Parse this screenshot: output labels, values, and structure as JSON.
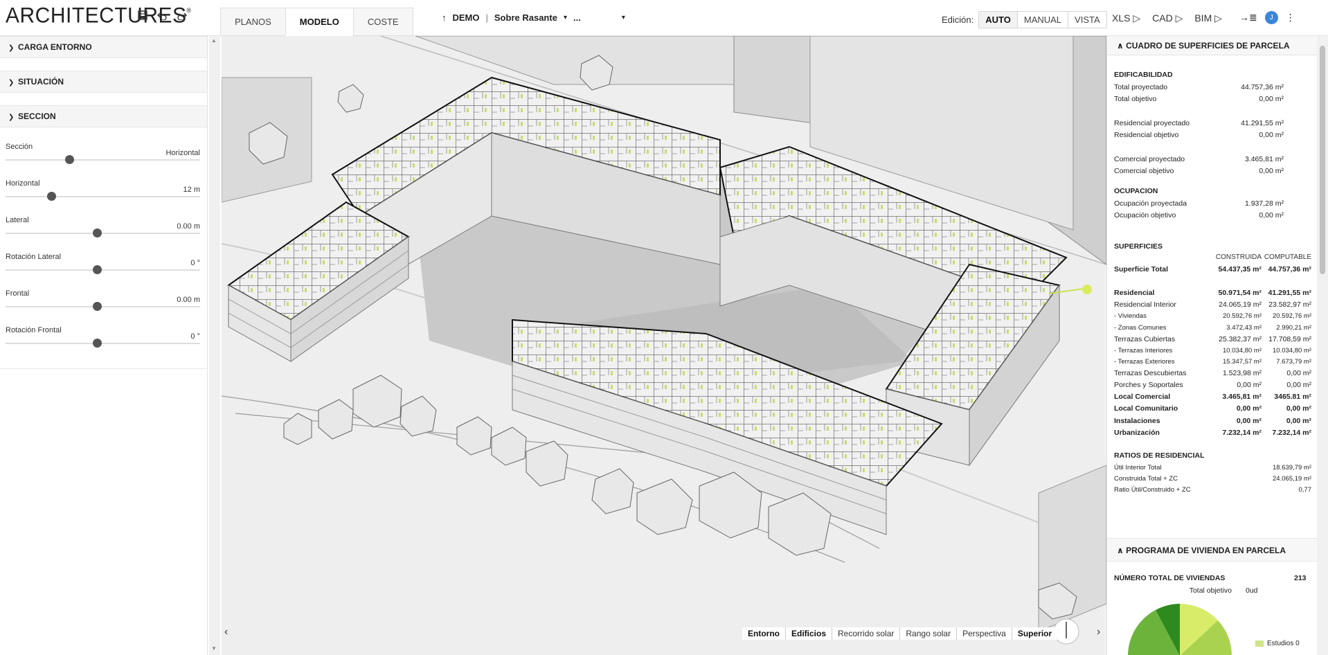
{
  "app": {
    "logo": "ARCHITECTURES",
    "logo_mark": "®"
  },
  "toolbar": {
    "save_icon": "save-icon",
    "undo_icon": "undo-icon",
    "redo_icon": "redo-icon"
  },
  "tabs": [
    {
      "label": "PLANOS"
    },
    {
      "label": "MODELO"
    },
    {
      "label": "COSTE"
    }
  ],
  "project": {
    "name": "DEMO",
    "level": "Sobre Rasante",
    "more": "..."
  },
  "edicion": {
    "label": "Edición:",
    "modes": [
      "AUTO",
      "MANUAL",
      "VISTA"
    ],
    "active": "AUTO"
  },
  "exports": [
    "XLS ▷",
    "CAD ▷",
    "BIM ▷"
  ],
  "user": {
    "initial": "J"
  },
  "left": {
    "sections": [
      "CARGA ENTORNO",
      "SITUACIÓN",
      "SECCION"
    ],
    "sliders": [
      {
        "label": "Sección",
        "value": "Horizontal",
        "level": 0.35
      },
      {
        "label": "Horizontal",
        "value": "12 m",
        "level": 0.25
      },
      {
        "label": "Lateral",
        "value": "0.00 m",
        "level": 0.5
      },
      {
        "label": "Rotación Lateral",
        "value": "0 °",
        "level": 0.5
      },
      {
        "label": "Frontal",
        "value": "0.00 m",
        "level": 0.5
      },
      {
        "label": "Rotación Frontal",
        "value": "0 °",
        "level": 0.5
      }
    ]
  },
  "view": {
    "modes": [
      "Entorno",
      "Edificios",
      "Recorrido solar",
      "Rango solar",
      "Perspectiva",
      "Superior"
    ],
    "bold_modes": [
      "Entorno",
      "Edificios",
      "Superior"
    ]
  },
  "right": {
    "cuadro_title": "CUADRO DE SUPERFICIES DE PARCELA",
    "edificabilidad": {
      "title": "EDIFICABILIDAD",
      "rows": [
        {
          "k": "Total proyectado",
          "v": "44.757,36 m²"
        },
        {
          "k": "Total objetivo",
          "v": "0,00 m²"
        },
        {
          "k": "Residencial proyectado",
          "v": "41.291,55 m²"
        },
        {
          "k": "Residencial objetivo",
          "v": "0,00 m²"
        },
        {
          "k": "Comercial proyectado",
          "v": "3.465,81 m²"
        },
        {
          "k": "Comercial objetivo",
          "v": "0,00 m²"
        }
      ]
    },
    "ocupacion": {
      "title": "OCUPACION",
      "rows": [
        {
          "k": "Ocupación proyectada",
          "v": "1.937,28 m²"
        },
        {
          "k": "Ocupación objetivo",
          "v": "0,00 m²"
        }
      ]
    },
    "superficies": {
      "title": "SUPERFICIES",
      "col1": "CONSTRUIDA",
      "col2": "COMPUTABLE",
      "total": {
        "k": "Superficie Total",
        "c1": "54.437,35 m²",
        "c2": "44.757,36 m²"
      },
      "rows": [
        {
          "k": "Residencial",
          "c1": "50.971,54 m²",
          "c2": "41.291,55 m²",
          "style": "bold"
        },
        {
          "k": "Residencial Interior",
          "c1": "24.065,19 m²",
          "c2": "23.582,97 m²",
          "style": "norm"
        },
        {
          "k": "- Viviendas",
          "c1": "20.592,76 m²",
          "c2": "20.592,76 m²",
          "style": "small"
        },
        {
          "k": "- Zonas Comunes",
          "c1": "3.472,43 m²",
          "c2": "2.990,21 m²",
          "style": "small"
        },
        {
          "k": "Terrazas Cubiertas",
          "c1": "25.382,37 m²",
          "c2": "17.708,59 m²",
          "style": "norm"
        },
        {
          "k": "- Terrazas Interiores",
          "c1": "10.034,80 m²",
          "c2": "10.034,80 m²",
          "style": "small"
        },
        {
          "k": "- Terrazas Exteriores",
          "c1": "15.347,57 m²",
          "c2": "7.673,79 m²",
          "style": "small"
        },
        {
          "k": "Terrazas Descubiertas",
          "c1": "1.523,98 m²",
          "c2": "0,00 m²",
          "style": "norm"
        },
        {
          "k": "Porches y Soportales",
          "c1": "0,00 m²",
          "c2": "0,00 m²",
          "style": "norm"
        },
        {
          "k": "Local Comercial",
          "c1": "3.465,81 m²",
          "c2": "3465.81 m²",
          "style": "bold"
        },
        {
          "k": "Local Comunitario",
          "c1": "0,00 m²",
          "c2": "0,00 m²",
          "style": "bold"
        },
        {
          "k": "Instalaciones",
          "c1": "0,00 m²",
          "c2": "0,00 m²",
          "style": "bold"
        },
        {
          "k": "Urbanización",
          "c1": "7.232,14 m²",
          "c2": "7.232,14 m²",
          "style": "bold"
        }
      ]
    },
    "ratios": {
      "title": "RATIOS DE RESIDENCIAL",
      "rows": [
        {
          "k": "Útil Interior Total",
          "v": "18.639,79 m²"
        },
        {
          "k": "Construida Total + ZC",
          "v": "24.065,19 m²"
        },
        {
          "k": "Ratio Útil/Construido + ZC",
          "v": "0,77"
        }
      ]
    },
    "programa": {
      "title": "PROGRAMA DE VIVIENDA EN PARCELA",
      "total_label": "NÚMERO TOTAL DE VIVIENDAS",
      "total_value": "213",
      "objetivo_label": "Total objetivo",
      "objetivo_value": "0ud",
      "legend_label": "Estudios 0"
    }
  },
  "colors": {
    "accent_green": "#c6de6a",
    "avatar_blue": "#3a86d8"
  }
}
